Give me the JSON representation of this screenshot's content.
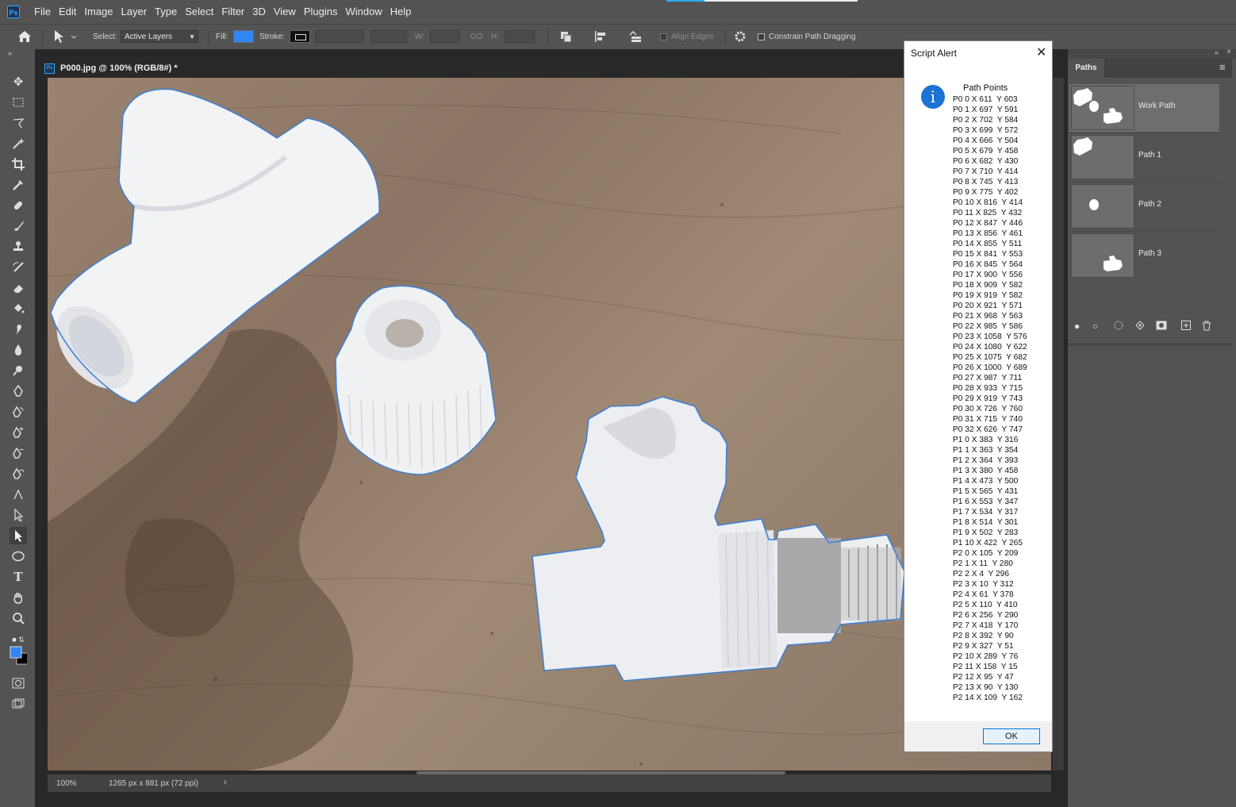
{
  "app": {
    "logo_text": "Ps",
    "menu": [
      "File",
      "Edit",
      "Image",
      "Layer",
      "Type",
      "Select",
      "Filter",
      "3D",
      "View",
      "Plugins",
      "Window",
      "Help"
    ]
  },
  "options_bar": {
    "select_label": "Select:",
    "select_value": "Active Layers",
    "fill_label": "Fill:",
    "fill_color": "#2f86f5",
    "stroke_label": "Stroke:",
    "w_label": "W:",
    "go_label": "GO",
    "h_label": "H:",
    "align_edges_label": "Align Edges",
    "constrain_label": "Constrain Path Dragging"
  },
  "document": {
    "tab_title": "P000.jpg @ 100% (RGB/8#) *",
    "zoom": "100%",
    "dimensions": "1265 px x 881 px (72 ppi)"
  },
  "alert": {
    "title": "Script Alert",
    "heading": "Path Points",
    "lines": [
      "P0 0 X 611  Y 603",
      "P0 1 X 697  Y 591",
      "P0 2 X 702  Y 584",
      "P0 3 X 699  Y 572",
      "P0 4 X 666  Y 504",
      "P0 5 X 679  Y 458",
      "P0 6 X 682  Y 430",
      "P0 7 X 710  Y 414",
      "P0 8 X 745  Y 413",
      "P0 9 X 775  Y 402",
      "P0 10 X 816  Y 414",
      "P0 11 X 825  Y 432",
      "P0 12 X 847  Y 446",
      "P0 13 X 856  Y 461",
      "P0 14 X 855  Y 511",
      "P0 15 X 841  Y 553",
      "P0 16 X 845  Y 564",
      "P0 17 X 900  Y 556",
      "P0 18 X 909  Y 582",
      "P0 19 X 919  Y 582",
      "P0 20 X 921  Y 571",
      "P0 21 X 968  Y 563",
      "P0 22 X 985  Y 586",
      "P0 23 X 1058  Y 576",
      "P0 24 X 1080  Y 622",
      "P0 25 X 1075  Y 682",
      "P0 26 X 1000  Y 689",
      "P0 27 X 987  Y 711",
      "P0 28 X 933  Y 715",
      "P0 29 X 919  Y 743",
      "P0 30 X 726  Y 760",
      "P0 31 X 715  Y 740",
      "P0 32 X 626  Y 747",
      "P1 0 X 383  Y 316",
      "P1 1 X 363  Y 354",
      "P1 2 X 364  Y 393",
      "P1 3 X 380  Y 458",
      "P1 4 X 473  Y 500",
      "P1 5 X 565  Y 431",
      "P1 6 X 553  Y 347",
      "P1 7 X 534  Y 317",
      "P1 8 X 514  Y 301",
      "P1 9 X 502  Y 283",
      "P1 10 X 422  Y 265",
      "P2 0 X 105  Y 209",
      "P2 1 X 11  Y 280",
      "P2 2 X 4  Y 296",
      "P2 3 X 10  Y 312",
      "P2 4 X 61  Y 378",
      "P2 5 X 110  Y 410",
      "P2 6 X 256  Y 290",
      "P2 7 X 418  Y 170",
      "P2 8 X 392  Y 90",
      "P2 9 X 327  Y 51",
      "P2 10 X 289  Y 76",
      "P2 11 X 158  Y 15",
      "P2 12 X 95  Y 47",
      "P2 13 X 90  Y 130",
      "P2 14 X 109  Y 162"
    ],
    "ok_label": "OK"
  },
  "paths_panel": {
    "tab_label": "Paths",
    "rows": [
      {
        "label": "Work Path"
      },
      {
        "label": "Path 1"
      },
      {
        "label": "Path 2"
      },
      {
        "label": "Path 3"
      }
    ]
  },
  "colors": {
    "accent": "#31a8ff",
    "foreground": "#2f86f5",
    "background": "#000000",
    "path_outline": "#3b7fd6"
  }
}
